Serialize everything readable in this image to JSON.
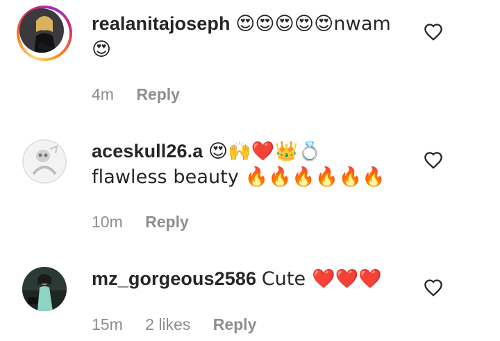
{
  "comments": [
    {
      "username": "realanitajoseph",
      "text": "😍😍😍😍😍nwam😍",
      "time": "4m",
      "likes": "",
      "reply_label": "Reply"
    },
    {
      "username": "aceskull26.a",
      "text": "😍🙌❤️👑💍 flawless beauty 🔥🔥🔥🔥🔥🔥",
      "time": "10m",
      "likes": "",
      "reply_label": "Reply"
    },
    {
      "username": "mz_gorgeous2586",
      "text": "Cute ❤️❤️❤️",
      "time": "15m",
      "likes": "2 likes",
      "reply_label": "Reply"
    }
  ],
  "colors": {
    "username": "#262626",
    "meta": "#8e8e8e",
    "story_ring": "#d62976"
  },
  "icons": {
    "like": "heart-outline-icon"
  }
}
